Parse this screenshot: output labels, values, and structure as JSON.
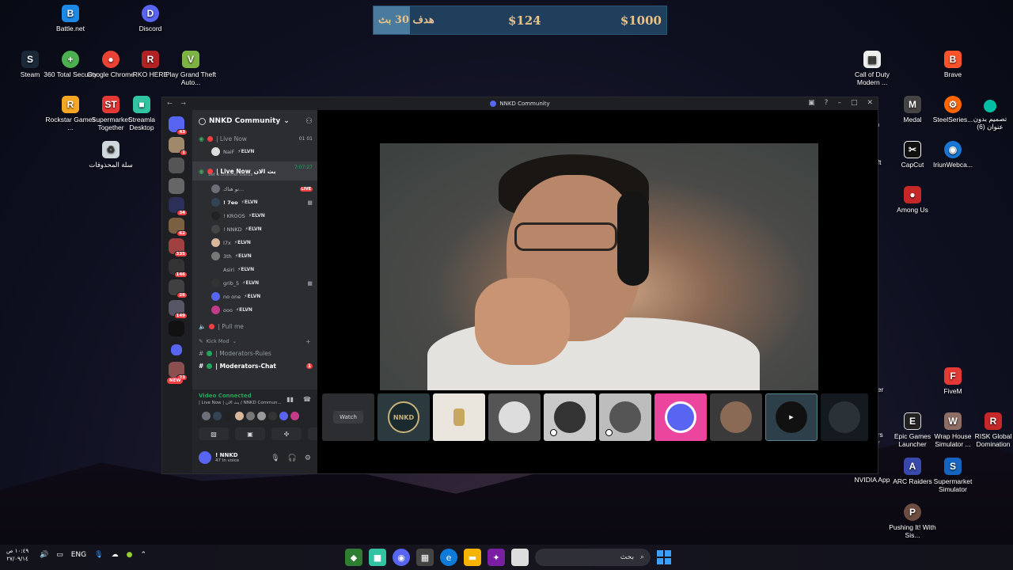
{
  "donation_bar": {
    "goal": "هدف 30 بث",
    "current": "$124",
    "target": "$1000"
  },
  "desktop_icons_left": [
    {
      "label": "Battle.net",
      "icon": "battle-net-icon",
      "color": "#1e88e5"
    },
    {
      "label": "Discord",
      "icon": "discord-icon",
      "color": "#5865f2"
    },
    {
      "label": "Steam",
      "icon": "steam-icon",
      "color": "#1b2838"
    },
    {
      "label": "360 Total Security",
      "icon": "security-icon",
      "color": "#4caf50"
    },
    {
      "label": "Google Chrome",
      "icon": "chrome-icon",
      "color": "#ea4335"
    },
    {
      "label": "RKO HERE",
      "icon": "archive-icon",
      "color": "#b22222"
    },
    {
      "label": "Play Grand Theft Auto...",
      "icon": "gta-icon",
      "color": "#7cb342"
    },
    {
      "label": "Rockstar Games ...",
      "icon": "rockstar-icon",
      "color": "#f5a623"
    },
    {
      "label": "Supermarket Together",
      "icon": "supermarket-icon",
      "color": "#e53935"
    },
    {
      "label": "Streamla Desktop",
      "icon": "streamlabs-icon",
      "color": "#31c3a2"
    },
    {
      "label": "سلة المحذوفات",
      "icon": "recycle-bin-icon",
      "color": "#9e9e9e"
    }
  ],
  "desktop_icons_right": [
    {
      "label": "Call of Duty Modern ...",
      "icon": "file-icon",
      "color": "#eeeeee"
    },
    {
      "label": "Brave",
      "icon": "brave-icon",
      "color": "#fb542b"
    },
    {
      "label": "Medal",
      "icon": "medal-icon",
      "color": "#444444"
    },
    {
      "label": "SteelSeries...",
      "icon": "steelseries-icon",
      "color": "#ff6600"
    },
    {
      "label": "تصميم بدون عنوان (6)",
      "icon": "image-icon",
      "color": "#00bfa5"
    },
    {
      "label": "CapCut",
      "icon": "capcut-icon",
      "color": "#111111"
    },
    {
      "label": "IriunWebca...",
      "icon": "webcam-icon",
      "color": "#1976d2"
    },
    {
      "label": "Among Us",
      "icon": "among-us-icon",
      "color": "#c62828"
    },
    {
      "label": "FiveM",
      "icon": "fivem-icon",
      "color": "#e53935"
    },
    {
      "label": "Epic Games Launcher",
      "icon": "epic-icon",
      "color": "#222222"
    },
    {
      "label": "Wrap House Simulator ...",
      "icon": "game-icon",
      "color": "#8d6e63"
    },
    {
      "label": "RISK Global Domination",
      "icon": "risk-icon",
      "color": "#c62828"
    },
    {
      "label": "NVIDIA App",
      "icon": "nvidia-icon",
      "color": "#76b900"
    },
    {
      "label": "ARC Raiders",
      "icon": "arc-icon",
      "color": "#3949ab"
    },
    {
      "label": "Supermarket Simulator",
      "icon": "supermarket-sim-icon",
      "color": "#1565c0"
    },
    {
      "label": "Pushing It! With Sis...",
      "icon": "game2-icon",
      "color": "#6d4c41"
    }
  ],
  "partial_labels": {
    "ft": "oft",
    "m": "m",
    "her": "her",
    "ors": "ors",
    "er": "er"
  },
  "window": {
    "title": "NNKD Community",
    "server_name": "NNKD Community",
    "guild_badges": [
      "43",
      "1",
      "34",
      "62",
      "335",
      "146",
      "26",
      "23",
      "149",
      "NEW"
    ],
    "channels": [
      {
        "name": "| Live Now",
        "type": "voice",
        "count_left": "01",
        "count_right": "01"
      },
      {
        "name": "| Live Now",
        "suffix": "بث الان",
        "time": "7:07:27",
        "status": "Set a channel status",
        "active": true
      },
      {
        "name": "| Pull me",
        "type": "voice"
      }
    ],
    "live_now_users": [
      {
        "name": "NaiF",
        "tag": "ELVN"
      }
    ],
    "active_users": [
      {
        "name": "نو هناك...",
        "tag": "",
        "live": "LIVE"
      },
      {
        "name": "! 7eo",
        "tag": "ELVN",
        "cam": true
      },
      {
        "name": "! KROOS",
        "tag": "ELVN"
      },
      {
        "name": "! NNKD",
        "tag": "ELVN"
      },
      {
        "name": "I7x",
        "tag": "ELVN"
      },
      {
        "name": "3th",
        "tag": "ELVN"
      },
      {
        "name": "Asiri",
        "tag": "ELVN"
      },
      {
        "name": "grib_5",
        "tag": "ELVN",
        "cam": true
      },
      {
        "name": "no one",
        "tag": "ELVN"
      },
      {
        "name": "ooo",
        "tag": "ELVN"
      }
    ],
    "category": "Kick Mod",
    "text_channels": [
      {
        "name": "| Moderators-Rules"
      },
      {
        "name": "| Moderators-Chat",
        "badge": "1"
      }
    ],
    "voice_panel": {
      "status": "Video Connected",
      "channel": "| Live Now | بث الان / NNKD Commun..."
    },
    "user": {
      "name": "! NNKD",
      "status": "47 In voice"
    },
    "tiles": [
      {
        "label": "Watch"
      },
      {
        "label": "NNKD"
      },
      {
        "label": ""
      },
      {
        "label": ""
      },
      {
        "label": ""
      },
      {
        "label": ""
      },
      {
        "label": ""
      },
      {
        "label": ""
      },
      {
        "label": ""
      },
      {
        "label": ""
      }
    ]
  },
  "taskbar": {
    "time": "١٠:٤٩ ص",
    "date": "٢٧/٠٩/١٤",
    "lang": "ENG",
    "search_placeholder": "بحث"
  }
}
